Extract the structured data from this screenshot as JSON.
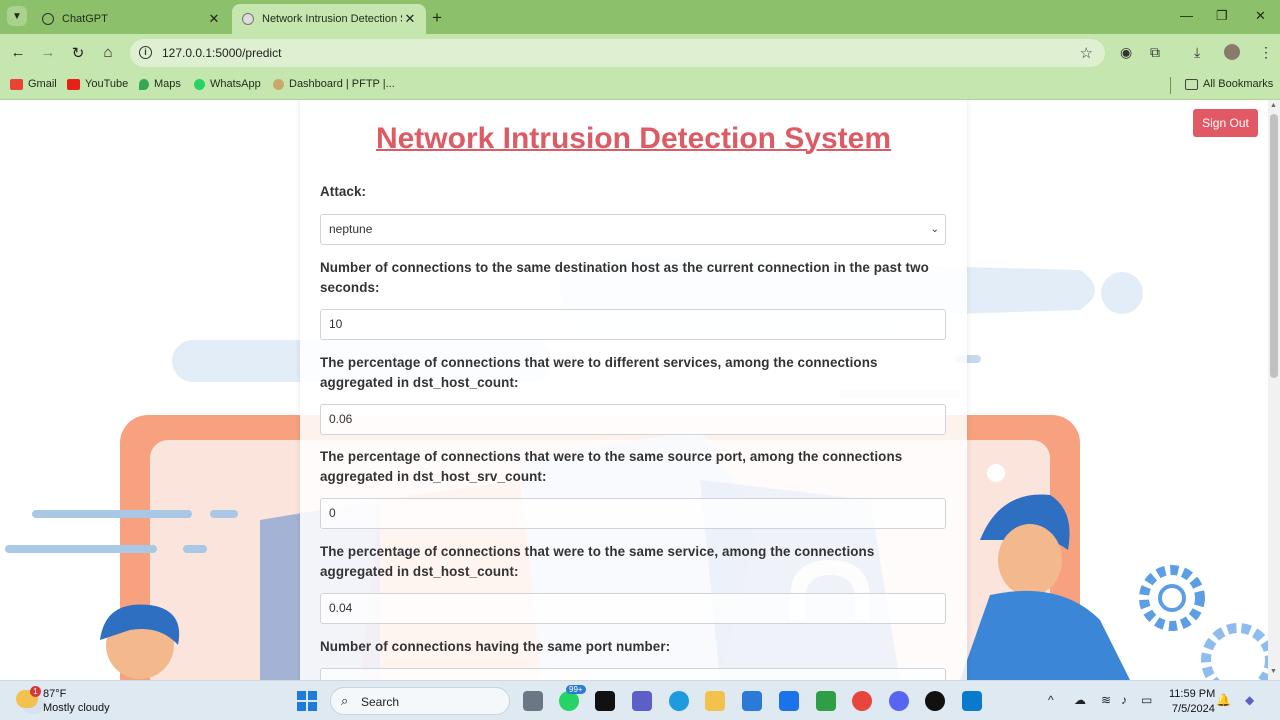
{
  "browser": {
    "tabs": [
      {
        "title": "ChatGPT"
      },
      {
        "title": "Network Intrusion Detection Sy"
      }
    ],
    "url": "127.0.0.1:5000/predict",
    "bookmarks": [
      "Gmail",
      "YouTube",
      "Maps",
      "WhatsApp",
      "Dashboard | PFTP |...",
      "All Bookmarks"
    ]
  },
  "page": {
    "title": "Network Intrusion Detection System",
    "signout_label": "Sign Out",
    "fields": [
      {
        "label": "Attack:",
        "value": "neptune",
        "type": "select"
      },
      {
        "label": "Number of connections to the same destination host as the current connection in the past two seconds:",
        "value": "10"
      },
      {
        "label": "The percentage of connections that were to different services, among the connections aggregated in dst_host_count:",
        "value": "0.06"
      },
      {
        "label": "The percentage of connections that were to the same source port, among the connections aggregated in dst_host_srv_count:",
        "value": "0"
      },
      {
        "label": "The percentage of connections that were to the same service, among the connections aggregated in dst_host_count:",
        "value": "0.04"
      },
      {
        "label": "Number of connections having the same port number:",
        "value": ""
      }
    ]
  },
  "taskbar": {
    "weather_temp": "87°F",
    "weather_desc": "Mostly cloudy",
    "weather_badge": "1",
    "search_label": "Search",
    "chat_badge": "99+",
    "time": "11:59 PM",
    "date": "7/5/2024"
  },
  "colors": {
    "title": "#dc5b64",
    "signout": "#e15965",
    "chrome": "#8dc06a"
  }
}
